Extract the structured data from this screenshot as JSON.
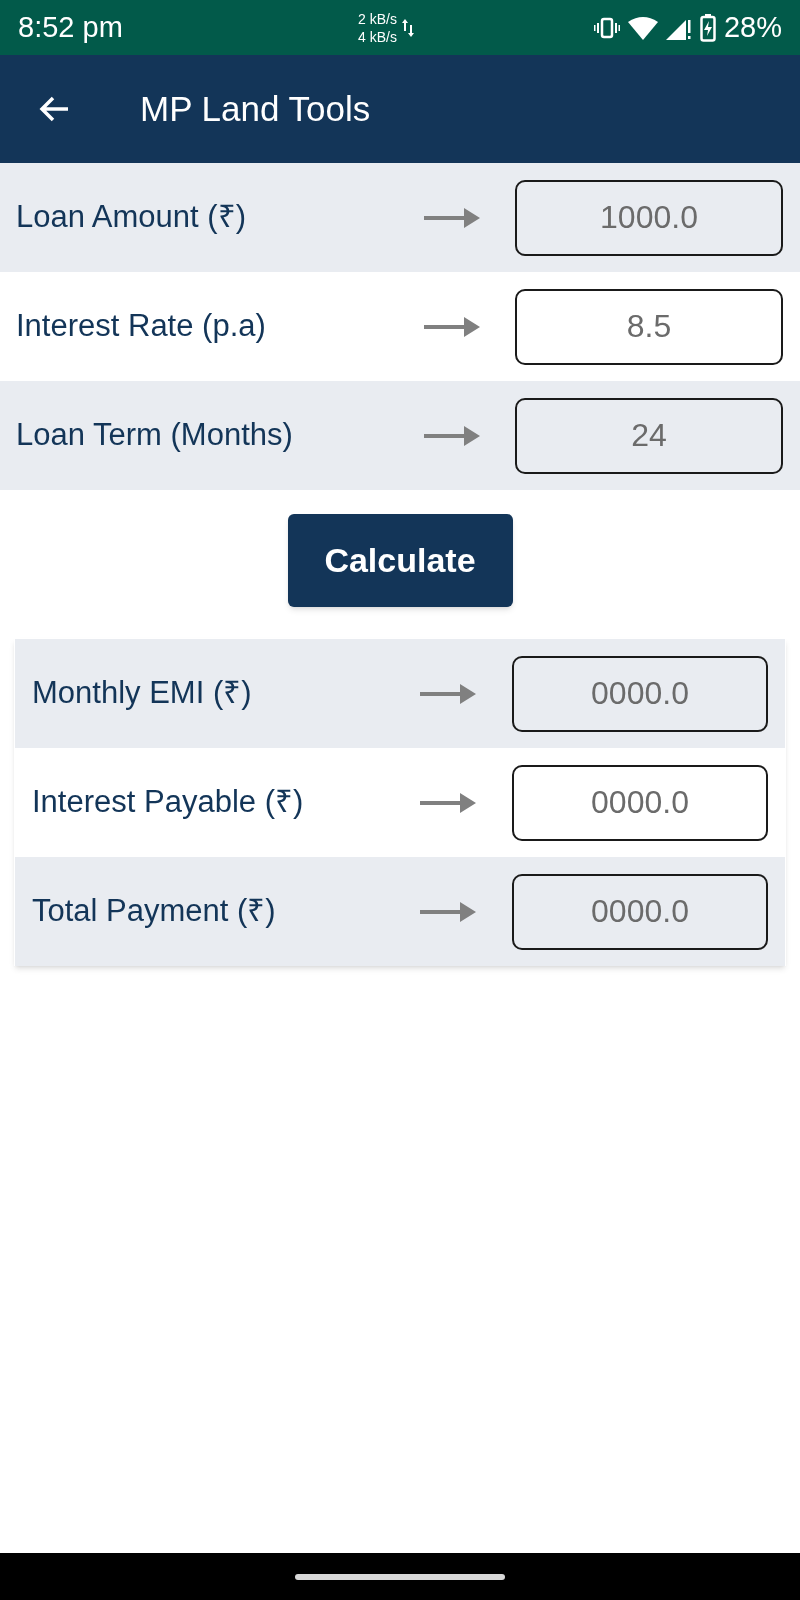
{
  "status_bar": {
    "time": "8:52 pm",
    "upload_speed": "2 kB/s",
    "download_speed": "4 kB/s",
    "battery": "28%"
  },
  "app_bar": {
    "title": "MP Land Tools"
  },
  "inputs": [
    {
      "label": "Loan Amount (₹)",
      "placeholder": "1000.0"
    },
    {
      "label": "Interest Rate (p.a)",
      "placeholder": "8.5"
    },
    {
      "label": "Loan Term (Months)",
      "placeholder": "24"
    }
  ],
  "calculate_button": "Calculate",
  "results": [
    {
      "label": "Monthly EMI (₹)",
      "placeholder": "0000.0"
    },
    {
      "label": "Interest Payable (₹)",
      "placeholder": "0000.0"
    },
    {
      "label": "Total Payment (₹)",
      "placeholder": "0000.0"
    }
  ]
}
